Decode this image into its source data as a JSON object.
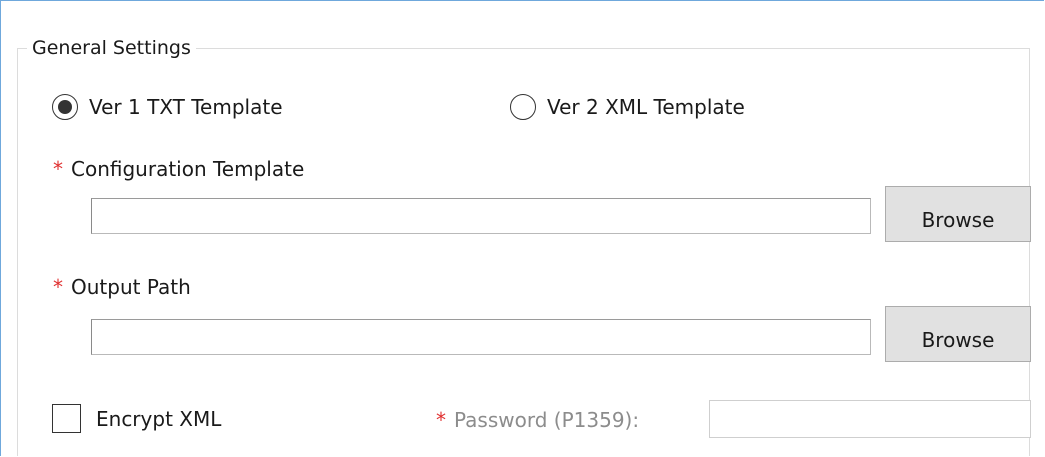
{
  "group": {
    "title": "General Settings"
  },
  "template_type": {
    "options": [
      {
        "label": "Ver 1 TXT Template",
        "selected": true
      },
      {
        "label": "Ver 2 XML Template",
        "selected": false
      }
    ]
  },
  "config_template": {
    "required_marker": "*",
    "label": "Configuration Template",
    "value": "",
    "browse_label": "Browse"
  },
  "output_path": {
    "required_marker": "*",
    "label": "Output Path",
    "value": "",
    "browse_label": "Browse"
  },
  "encrypt": {
    "label": "Encrypt XML",
    "checked": false
  },
  "password": {
    "required_marker": "*",
    "label": "Password (P1359):",
    "value": "",
    "disabled": true
  },
  "colors": {
    "required": "#e03030",
    "disabled_text": "#8c8c8c",
    "button_face": "#e1e1e1",
    "panel_border": "#6fa8dc"
  }
}
